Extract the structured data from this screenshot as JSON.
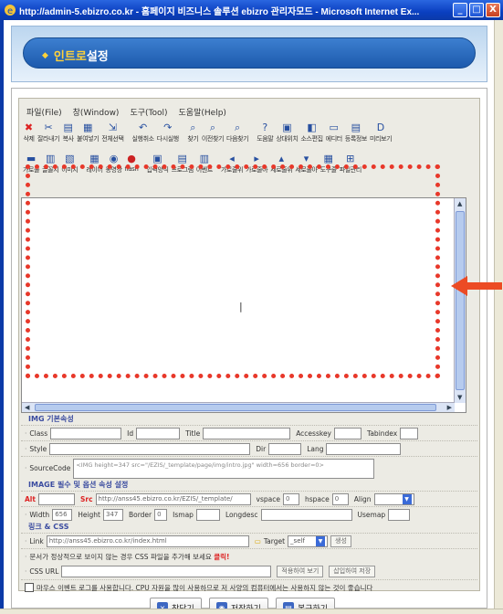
{
  "window": {
    "title": "http://admin-5.ebizro.co.kr - 홈페이지 비즈니스 솔루션 ebizro 관리자모드 - Microsoft Internet Ex...",
    "minimize": "_",
    "maximize": "□",
    "close": "X"
  },
  "header": {
    "title_accent": "인트로",
    "title_rest": "설정"
  },
  "menubar": [
    "파일(File)",
    "창(Window)",
    "도구(Tool)",
    "도움말(Help)"
  ],
  "toolbar1": [
    {
      "icon": "✖",
      "label": "삭제",
      "color": "#d22"
    },
    {
      "icon": "✂",
      "label": "잘라내기"
    },
    {
      "icon": "▤",
      "label": "복사"
    },
    {
      "icon": "▦",
      "label": "붙여넣기"
    },
    {
      "icon": "⇲",
      "label": "전체선택"
    },
    {
      "icon": "↶",
      "label": "실행취소"
    },
    {
      "icon": "↷",
      "label": "다시실행"
    },
    {
      "icon": "⌕",
      "label": "찾기"
    },
    {
      "icon": "⌕",
      "label": "이전찾기"
    },
    {
      "icon": "⌕",
      "label": "다음찾기"
    },
    {
      "icon": "?",
      "label": "도움말"
    },
    {
      "icon": "▣",
      "label": "상대위치"
    },
    {
      "icon": "◧",
      "label": "소스편집"
    },
    {
      "icon": "▭",
      "label": "에디터"
    },
    {
      "icon": "▤",
      "label": "등록정보"
    },
    {
      "icon": "D",
      "label": "미리보기"
    }
  ],
  "toolbar2": [
    {
      "icon": "▬",
      "label": "가로줄"
    },
    {
      "icon": "▥",
      "label": "글꼴지"
    },
    {
      "icon": "▧",
      "label": "이미지"
    },
    {
      "icon": "▦",
      "label": "레이어"
    },
    {
      "icon": "◉",
      "label": "동영상"
    },
    {
      "icon": "●",
      "label": "flash",
      "color": "#c22"
    },
    {
      "icon": "▣",
      "label": "입력양식"
    },
    {
      "icon": "▤",
      "label": "프로그램"
    },
    {
      "icon": "▥",
      "label": "이벤트"
    },
    {
      "icon": "◂",
      "label": "가로줄위"
    },
    {
      "icon": "▸",
      "label": "가로줄아"
    },
    {
      "icon": "▴",
      "label": "세로줄위"
    },
    {
      "icon": "▾",
      "label": "세로줄아"
    },
    {
      "icon": "▦",
      "label": "도구줄"
    },
    {
      "icon": "⊞",
      "label": "파일관리"
    }
  ],
  "img_section": {
    "title": "IMG 기본속성",
    "class_label": "Class",
    "id_label": "Id",
    "title_label": "Title",
    "accesskey_label": "Accesskey",
    "tabindex_label": "Tabindex",
    "style_label": "Style",
    "dir_label": "Dir",
    "lang_label": "Lang",
    "sourcecode_label": "SourceCode",
    "sourcecode_value": "<IMG height=347 src=\"/EZIS/_template/page/img/intro.jpg\" width=656 border=0>"
  },
  "img_options": {
    "title": "IMAGE 필수 및 옵션 속성 설정",
    "alt_label": "Alt",
    "src_label": "Src",
    "src_value": "http://anss45.ebizro.co.kr/EZIS/_template/",
    "vspace_label": "vspace",
    "vspace_value": "0",
    "hspace_label": "hspace",
    "hspace_value": "0",
    "align_label": "Align",
    "width_label": "Width",
    "width_value": "656",
    "height_label": "Height",
    "height_value": "347",
    "border_label": "Border",
    "border_value": "0",
    "ismap_label": "Ismap",
    "longdesc_label": "Longdesc",
    "usemap_label": "Usemap"
  },
  "link_css": {
    "title": "링크 & CSS",
    "link_label": "Link",
    "link_value": "http://anss45.ebizro.co.kr/index.html",
    "target_label": "Target",
    "target_value": "_self",
    "create_label": "생성",
    "notice": "문서가 정상적으로 보이지 않는 경우 CSS 파일을 추가해 보세요",
    "notice_red": "클릭!",
    "css_label": "CSS URL",
    "apply_button": "적용하여 보기",
    "insert_button": "삽입하여 저장",
    "mouse_event_note": "마우스 이벤트 로그를 사용합니다. CPU 자원을 많이 사용하므로 저 사양의 컴퓨터에서는 사용하지 않는 것이 좋습니다"
  },
  "buttons": {
    "close": "창닫기",
    "save": "저장하기",
    "restore": "복구하기"
  }
}
